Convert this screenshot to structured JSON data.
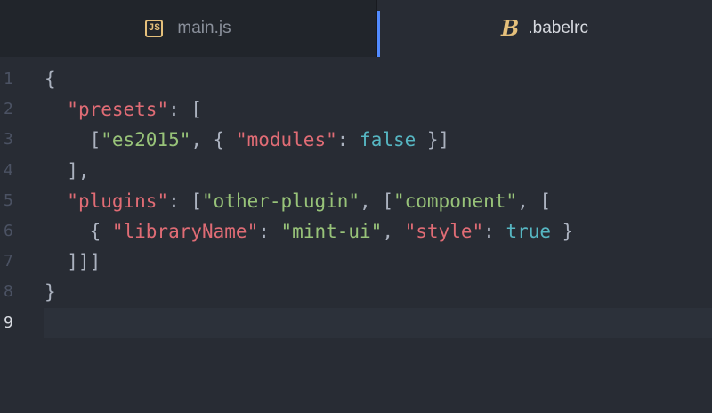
{
  "tabs": [
    {
      "label": "main.js",
      "icon": "js-file-icon",
      "icon_text": "JS"
    },
    {
      "label": ".babelrc",
      "icon": "babel-file-icon",
      "icon_text": "B"
    }
  ],
  "line_numbers": [
    "1",
    "2",
    "3",
    "4",
    "5",
    "6",
    "7",
    "8",
    "9"
  ],
  "code": {
    "l1": {
      "p1": "{"
    },
    "l2": {
      "p1": "  ",
      "k1": "\"presets\"",
      "p2": ": ["
    },
    "l3": {
      "p1": "    [",
      "s1": "\"es2015\"",
      "p2": ", { ",
      "k1": "\"modules\"",
      "p3": ": ",
      "b1": "false",
      "p4": " }]"
    },
    "l4": {
      "p1": "  ],"
    },
    "l5": {
      "p1": "  ",
      "k1": "\"plugins\"",
      "p2": ": [",
      "s1": "\"other-plugin\"",
      "p3": ", [",
      "s2": "\"component\"",
      "p4": ", ["
    },
    "l6": {
      "p1": "    { ",
      "k1": "\"libraryName\"",
      "p2": ": ",
      "s1": "\"mint-ui\"",
      "p3": ", ",
      "k2": "\"style\"",
      "p4": ": ",
      "b1": "true",
      "p5": " }"
    },
    "l7": {
      "p1": "  ]]]"
    },
    "l8": {
      "p1": "}"
    },
    "l9": {
      "p1": ""
    }
  },
  "colors": {
    "key": "#e06c75",
    "string": "#98c379",
    "boolean": "#56b6c2",
    "punctuation": "#abb2bf",
    "tab_accent": "#528bff",
    "icon": "#e5c07b"
  }
}
